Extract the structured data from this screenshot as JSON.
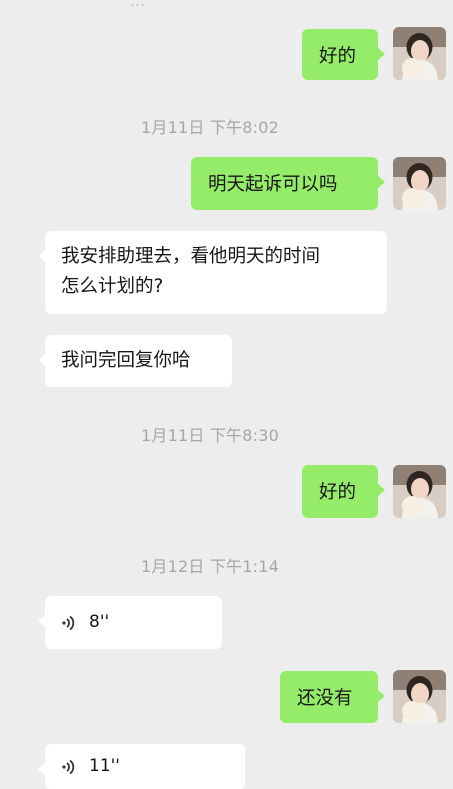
{
  "top_partial_text": "…",
  "messages": [
    {
      "type": "text",
      "side": "me",
      "text": "好的"
    },
    {
      "type": "time",
      "text": "1月11日 下午8:02"
    },
    {
      "type": "text",
      "side": "me",
      "text": "明天起诉可以吗"
    },
    {
      "type": "text",
      "side": "other",
      "lines": [
        "我安排助理去，看他明天的时间",
        "怎么计划的?"
      ]
    },
    {
      "type": "text",
      "side": "other",
      "text": "我问完回复你哈"
    },
    {
      "type": "time",
      "text": "1月11日 下午8:30"
    },
    {
      "type": "text",
      "side": "me",
      "text": "好的"
    },
    {
      "type": "time",
      "text": "1月12日 下午1:14"
    },
    {
      "type": "voice",
      "side": "other",
      "duration": "8''"
    },
    {
      "type": "text",
      "side": "me",
      "text": "还没有"
    },
    {
      "type": "voice",
      "side": "other",
      "duration": "11''"
    }
  ],
  "avatar_icon": "user-avatar-photo",
  "voice_icon": "voice-wave-icon",
  "colors": {
    "background": "#ededed",
    "my_bubble": "#95ec69",
    "other_bubble": "#ffffff",
    "timestamp": "#a6a6a6"
  }
}
